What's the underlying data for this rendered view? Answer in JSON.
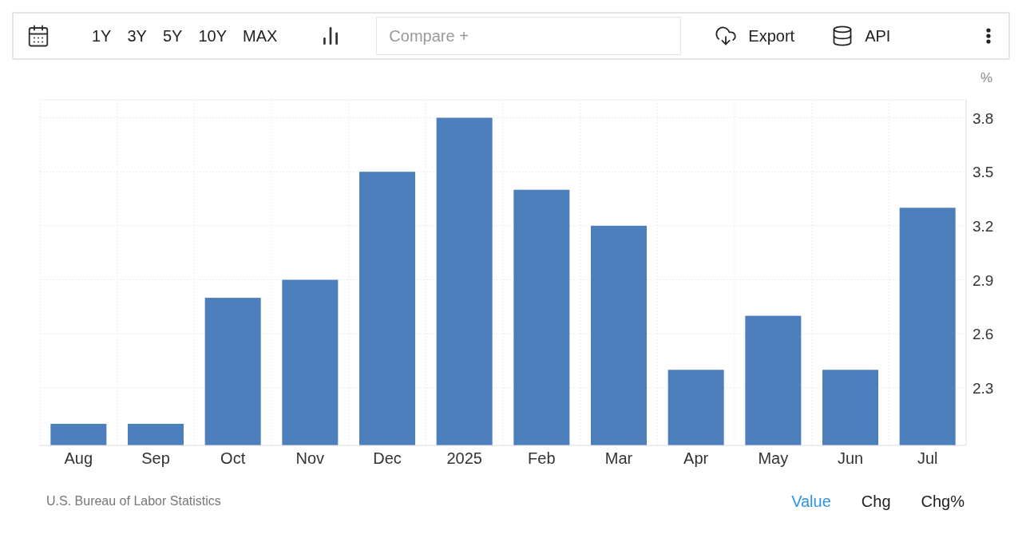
{
  "toolbar": {
    "ranges": [
      "1Y",
      "3Y",
      "5Y",
      "10Y",
      "MAX"
    ],
    "compare": {
      "placeholder": "Compare +"
    },
    "export": "Export",
    "api": "API"
  },
  "chart": {
    "chart_data": {
      "type": "bar",
      "ylabel": "%",
      "categories": [
        "Aug",
        "Sep",
        "Oct",
        "Nov",
        "Dec",
        "2025",
        "Feb",
        "Mar",
        "Apr",
        "May",
        "Jun",
        "Jul"
      ],
      "grid": true,
      "series": [
        {
          "color": "#4d7fbd",
          "values": [
            2.1,
            2.1,
            2.8,
            2.9,
            3.5,
            3.8,
            3.4,
            3.2,
            2.4,
            2.7,
            2.4,
            3.3
          ]
        }
      ],
      "ylim": [
        1.98,
        3.9
      ],
      "yticks": [
        2.3,
        2.6,
        2.9,
        3.2,
        3.5,
        3.8
      ]
    }
  },
  "footer": {
    "source": "U.S. Bureau of Labor Statistics",
    "views": [
      {
        "label": "Value",
        "selected": true
      },
      {
        "label": "Chg",
        "selected": false
      },
      {
        "label": "Chg%",
        "selected": false
      }
    ]
  }
}
